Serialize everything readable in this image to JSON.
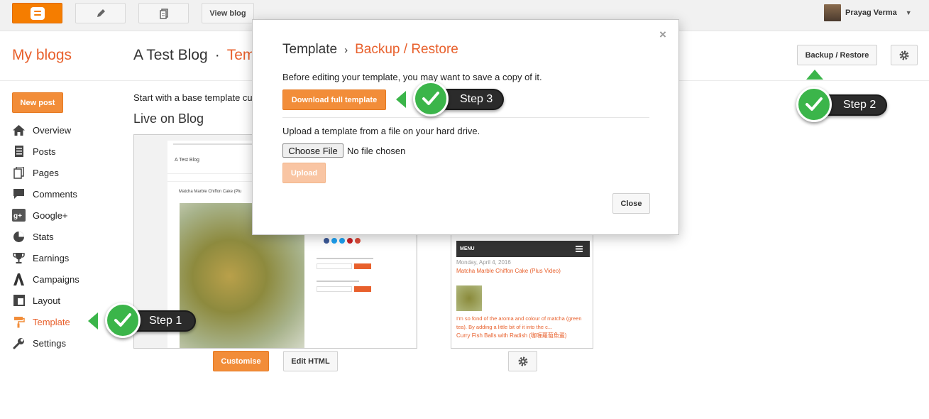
{
  "topbar": {
    "view_blog_label": "View blog",
    "user_name": "Prayag Verma",
    "user_caret": "▼"
  },
  "header": {
    "my_blogs": "My blogs",
    "blog_title": "A Test Blog",
    "separator": "·",
    "section": "Template",
    "backup_restore_label": "Backup / Restore"
  },
  "sidebar": {
    "new_post_label": "New post",
    "items": [
      {
        "label": "Overview",
        "icon": "home-icon"
      },
      {
        "label": "Posts",
        "icon": "posts-icon"
      },
      {
        "label": "Pages",
        "icon": "pages-icon"
      },
      {
        "label": "Comments",
        "icon": "comments-icon"
      },
      {
        "label": "Google+",
        "icon": "google-plus-icon"
      },
      {
        "label": "Stats",
        "icon": "stats-icon"
      },
      {
        "label": "Earnings",
        "icon": "earnings-icon"
      },
      {
        "label": "Campaigns",
        "icon": "campaigns-icon"
      },
      {
        "label": "Layout",
        "icon": "layout-icon"
      },
      {
        "label": "Template",
        "icon": "template-icon",
        "active": true
      },
      {
        "label": "Settings",
        "icon": "settings-icon"
      }
    ]
  },
  "main": {
    "intro_text": "Start with a base template cu",
    "live_heading": "Live on Blog",
    "desktop_preview": {
      "blog_title": "A Test Blog",
      "post_title": "Matcha Marble Chiffon Cake (Plu"
    },
    "customise_label": "Customise",
    "edit_html_label": "Edit HTML",
    "mobile_preview": {
      "menu_label": "MENU",
      "date": "Monday, April 4, 2016",
      "post_title": "Matcha Marble Chiffon Cake (Plus Video)",
      "excerpt": "I'm so fond of the aroma and colour of matcha (green tea). By adding a little bit of it into the c...",
      "post2_title": "Curry Fish Balls with Radish (咖喱蘿蔔魚蛋)"
    }
  },
  "dialog": {
    "crumb1": "Template",
    "chevron": "›",
    "crumb2": "Backup / Restore",
    "close_x": "×",
    "save_text": "Before editing your template, you may want to save a copy of it.",
    "download_label": "Download full template",
    "upload_text": "Upload a template from a file on your hard drive.",
    "choose_file_label": "Choose File",
    "no_file_text": "No file chosen",
    "upload_label": "Upload",
    "close_label": "Close"
  },
  "steps": {
    "step1": "Step 1",
    "step2": "Step 2",
    "step3": "Step 3"
  },
  "colors": {
    "accent_orange": "#f28d39",
    "link_orange": "#e8602c",
    "step_green": "#3bb54a"
  }
}
